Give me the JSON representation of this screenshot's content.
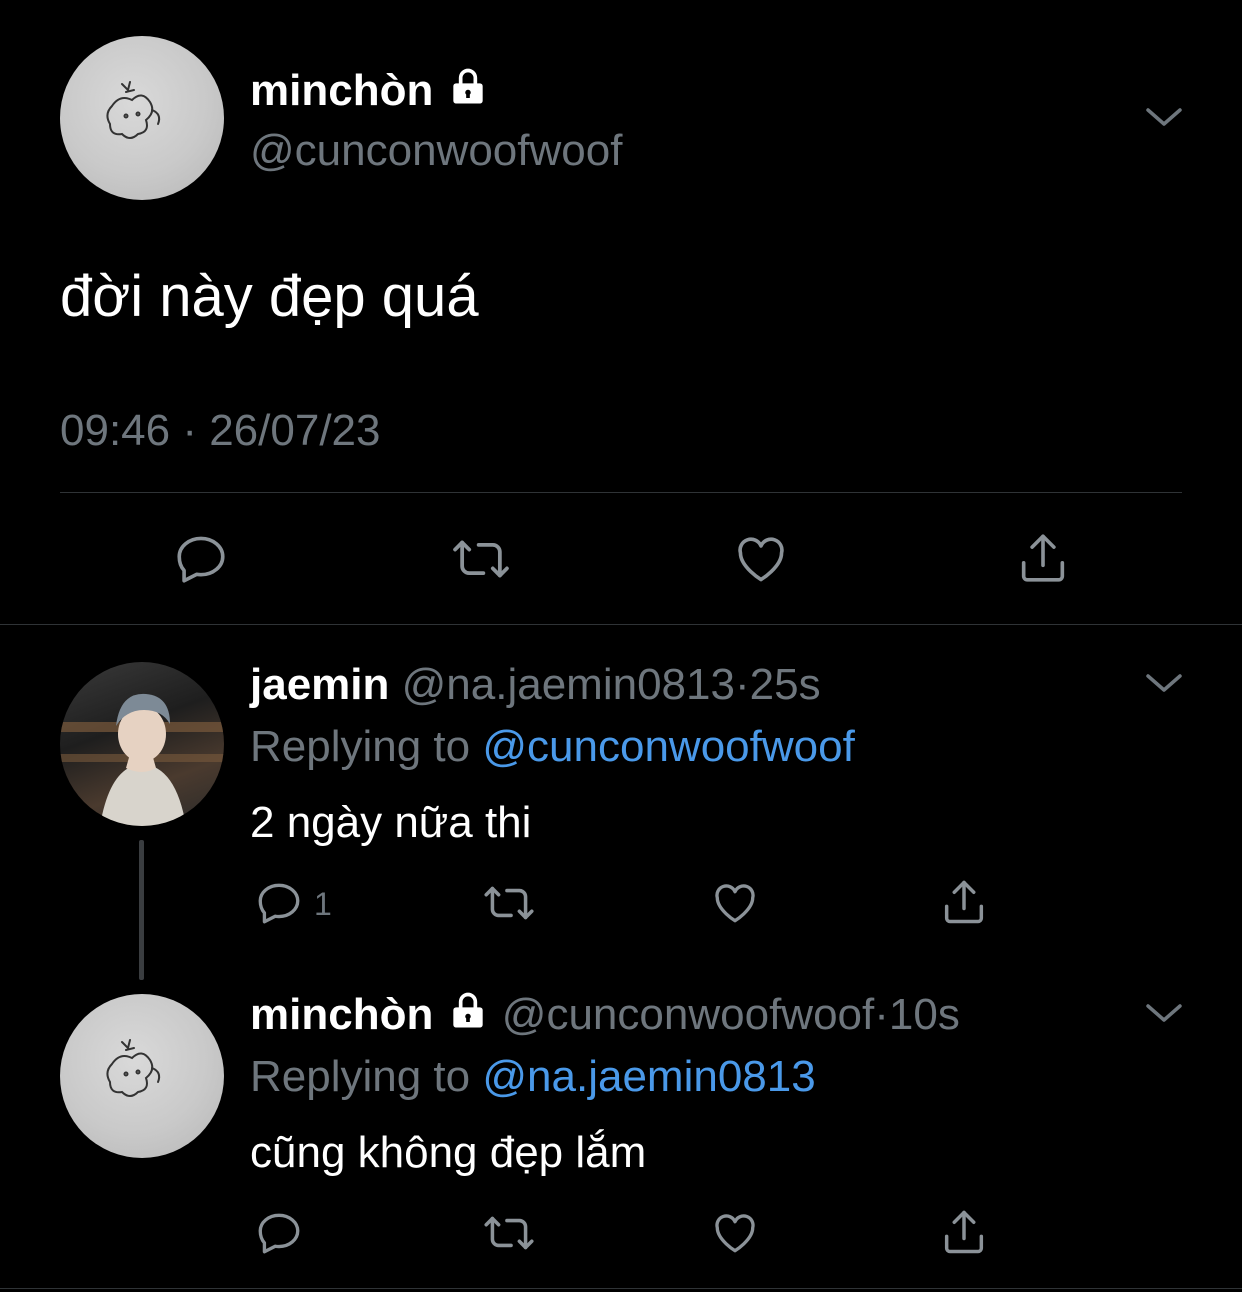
{
  "main_tweet": {
    "display_name": "minchòn",
    "handle": "@cunconwoofwoof",
    "text": "đời này đẹp quá",
    "timestamp": "09:46 · 26/07/23",
    "protected_icon": "lock-icon",
    "actions": [
      "reply-icon",
      "retweet-icon",
      "like-icon",
      "share-icon"
    ]
  },
  "replies": [
    {
      "display_name": "jaemin",
      "handle": "@na.jaemin0813",
      "separator": "·",
      "age": "25s",
      "replying_prefix": "Replying to",
      "replying_to": "@cunconwoofwoof",
      "text": "2 ngày nữa thi",
      "reply_count": "1"
    },
    {
      "display_name": "minchòn",
      "handle": "@cunconwoofwoof",
      "separator": "·",
      "age": "10s",
      "replying_prefix": "Replying to",
      "replying_to": "@na.jaemin0813",
      "text": "cũng không đẹp lắm",
      "reply_count": ""
    }
  ],
  "colors": {
    "background": "#000000",
    "muted": "#6e767d",
    "link": "#4a99e9",
    "divider": "#2f3336"
  }
}
